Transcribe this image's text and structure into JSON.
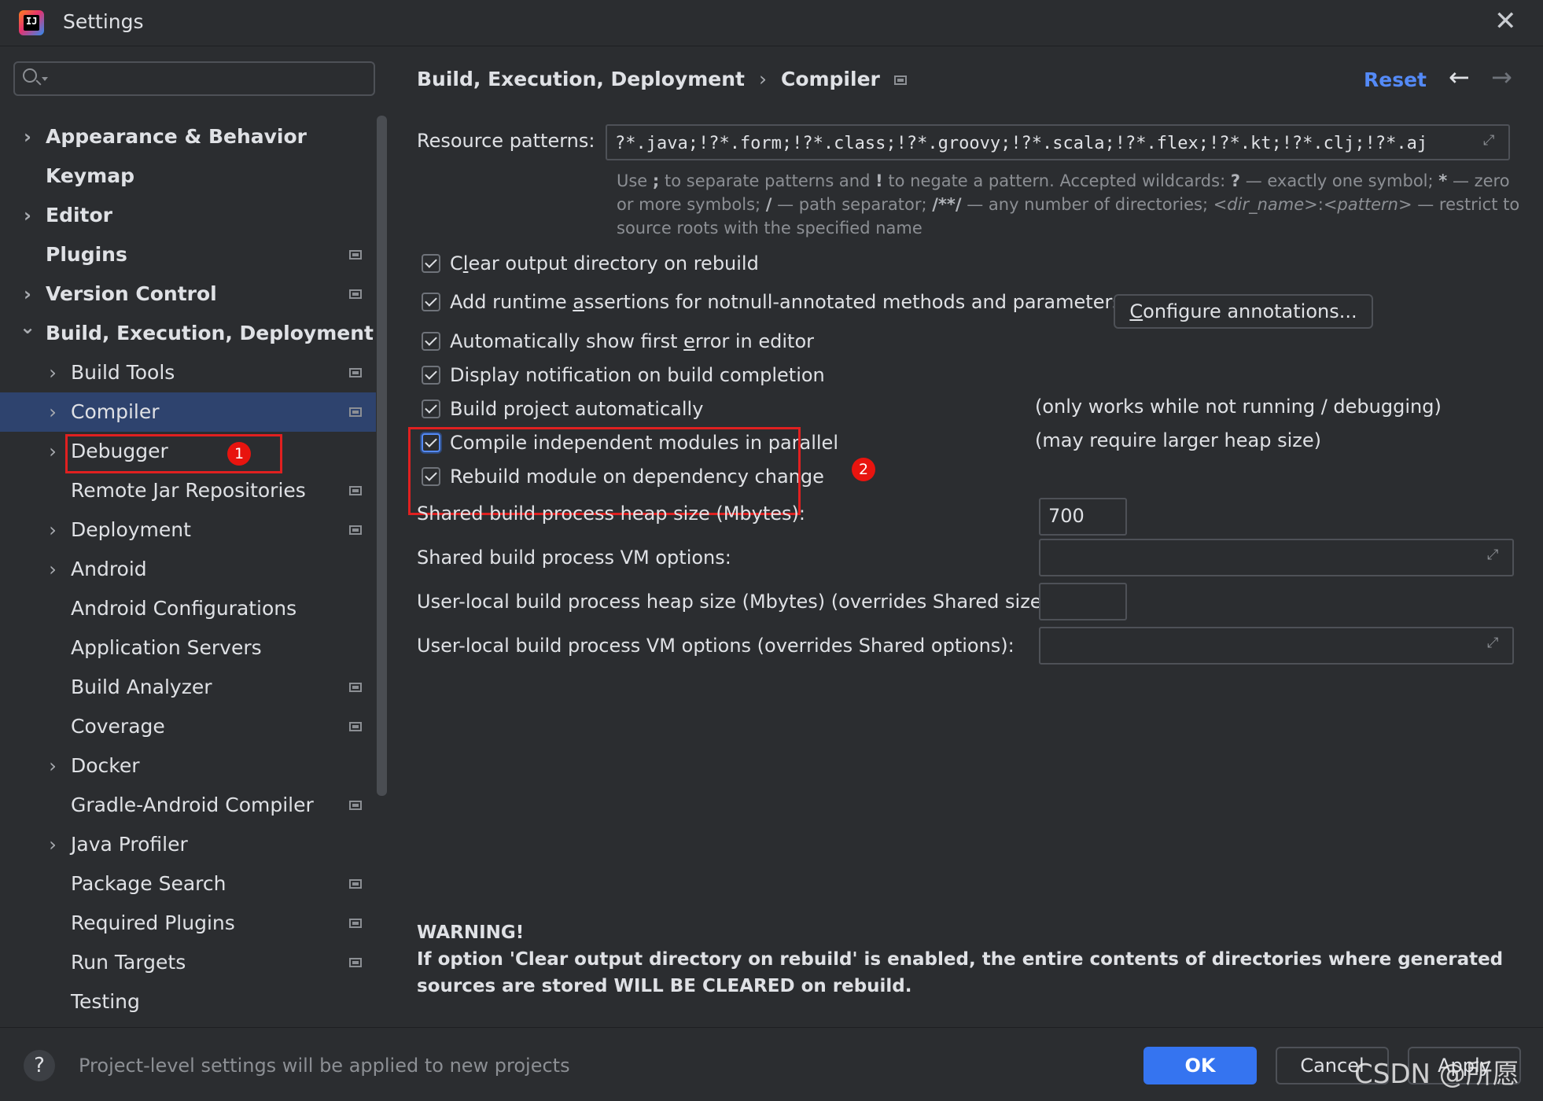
{
  "window": {
    "title": "Settings",
    "logo_text": "IJ"
  },
  "sidebar": {
    "search_placeholder": "",
    "items": [
      {
        "label": "Appearance & Behavior",
        "level": 0,
        "bold": true,
        "expandable": true,
        "expanded": false,
        "project_scope": false
      },
      {
        "label": "Keymap",
        "level": 0,
        "bold": true,
        "expandable": false,
        "project_scope": false
      },
      {
        "label": "Editor",
        "level": 0,
        "bold": true,
        "expandable": true,
        "expanded": false,
        "project_scope": false
      },
      {
        "label": "Plugins",
        "level": 0,
        "bold": true,
        "expandable": false,
        "project_scope": true
      },
      {
        "label": "Version Control",
        "level": 0,
        "bold": true,
        "expandable": true,
        "expanded": false,
        "project_scope": true
      },
      {
        "label": "Build, Execution, Deployment",
        "level": 0,
        "bold": true,
        "expandable": true,
        "expanded": true,
        "project_scope": false
      },
      {
        "label": "Build Tools",
        "level": 1,
        "expandable": true,
        "project_scope": true
      },
      {
        "label": "Compiler",
        "level": 1,
        "expandable": true,
        "project_scope": true,
        "selected": true
      },
      {
        "label": "Debugger",
        "level": 1,
        "expandable": true,
        "project_scope": false
      },
      {
        "label": "Remote Jar Repositories",
        "level": 1,
        "expandable": false,
        "project_scope": true
      },
      {
        "label": "Deployment",
        "level": 1,
        "expandable": true,
        "project_scope": true
      },
      {
        "label": "Android",
        "level": 1,
        "expandable": true,
        "project_scope": false
      },
      {
        "label": "Android Configurations",
        "level": 1,
        "expandable": false,
        "project_scope": false
      },
      {
        "label": "Application Servers",
        "level": 1,
        "expandable": false,
        "project_scope": false
      },
      {
        "label": "Build Analyzer",
        "level": 1,
        "expandable": false,
        "project_scope": true
      },
      {
        "label": "Coverage",
        "level": 1,
        "expandable": false,
        "project_scope": true
      },
      {
        "label": "Docker",
        "level": 1,
        "expandable": true,
        "project_scope": false
      },
      {
        "label": "Gradle-Android Compiler",
        "level": 1,
        "expandable": false,
        "project_scope": true
      },
      {
        "label": "Java Profiler",
        "level": 1,
        "expandable": true,
        "project_scope": false
      },
      {
        "label": "Package Search",
        "level": 1,
        "expandable": false,
        "project_scope": true
      },
      {
        "label": "Required Plugins",
        "level": 1,
        "expandable": false,
        "project_scope": true
      },
      {
        "label": "Run Targets",
        "level": 1,
        "expandable": false,
        "project_scope": true
      },
      {
        "label": "Testing",
        "level": 1,
        "expandable": false,
        "project_scope": false
      }
    ],
    "annotation_1": "1"
  },
  "main": {
    "breadcrumb_parent": "Build, Execution, Deployment",
    "breadcrumb_sep": "›",
    "breadcrumb_current": "Compiler",
    "reset_label": "Reset",
    "back_icon": "←",
    "forward_icon": "→",
    "resource_patterns_label": "Resource patterns:",
    "resource_patterns_value": "?*.java;!?*.form;!?*.class;!?*.groovy;!?*.scala;!?*.flex;!?*.kt;!?*.clj;!?*.aj",
    "help": {
      "t1": "Use ",
      "b1": ";",
      "t2": " to separate patterns and ",
      "b2": "!",
      "t3": " to negate a pattern. Accepted wildcards: ",
      "b3": "?",
      "t4": " — exactly one symbol; ",
      "b4": "*",
      "t5": " — zero or more symbols; ",
      "b5": "/",
      "t6": " — path separator; ",
      "b6": "/**/",
      "t7": " — any number of directories; ",
      "i1": "<dir_name>",
      "t8": ":",
      "i2": "<pattern>",
      "t9": " — restrict to source roots with the specified name"
    },
    "options": {
      "clear_output": {
        "pre": "C",
        "u": "l",
        "post": "ear output directory on rebuild",
        "checked": true
      },
      "runtime_assertions": {
        "pre": "Add runtime ",
        "u": "a",
        "post": "ssertions for notnull-annotated methods and parameters",
        "checked": true
      },
      "configure_annotations": {
        "pre": "",
        "u": "C",
        "post": "onfigure annotations..."
      },
      "show_first_error": {
        "pre": "Automatically show first ",
        "u": "e",
        "post": "rror in editor",
        "checked": true
      },
      "notification": {
        "label": "Display notification on build completion",
        "checked": true
      },
      "build_auto": {
        "label": "Build project automatically",
        "checked": true,
        "note": "(only works while not running / debugging)"
      },
      "parallel": {
        "label": "Compile independent modules in parallel",
        "checked": true,
        "note": "(may require larger heap size)"
      },
      "rebuild_module": {
        "label": "Rebuild module on dependency change",
        "checked": true
      }
    },
    "annotation_2": "2",
    "heap_label": "Shared build process heap size (Mbytes):",
    "heap_value": "700",
    "vm_label": "Shared build process VM options:",
    "vm_value": "",
    "user_heap_label": "User-local build process heap size (Mbytes) (overrides Shared size):",
    "user_heap_value": "",
    "user_vm_label": "User-local build process VM options (overrides Shared options):",
    "user_vm_value": "",
    "warning_title": "WARNING!",
    "warning_text": "If option 'Clear output directory on rebuild' is enabled, the entire contents of directories where generated sources are stored WILL BE CLEARED on rebuild."
  },
  "footer": {
    "help_label": "?",
    "text": "Project-level settings will be applied to new projects",
    "ok": "OK",
    "cancel": "Cancel",
    "apply": "Apply"
  },
  "watermark": "CSDN @所愿",
  "colors": {
    "accent": "#3574f0",
    "selection": "#2e436e",
    "link": "#548af7",
    "annotation_red": "#e02020",
    "background": "#2b2d30"
  }
}
